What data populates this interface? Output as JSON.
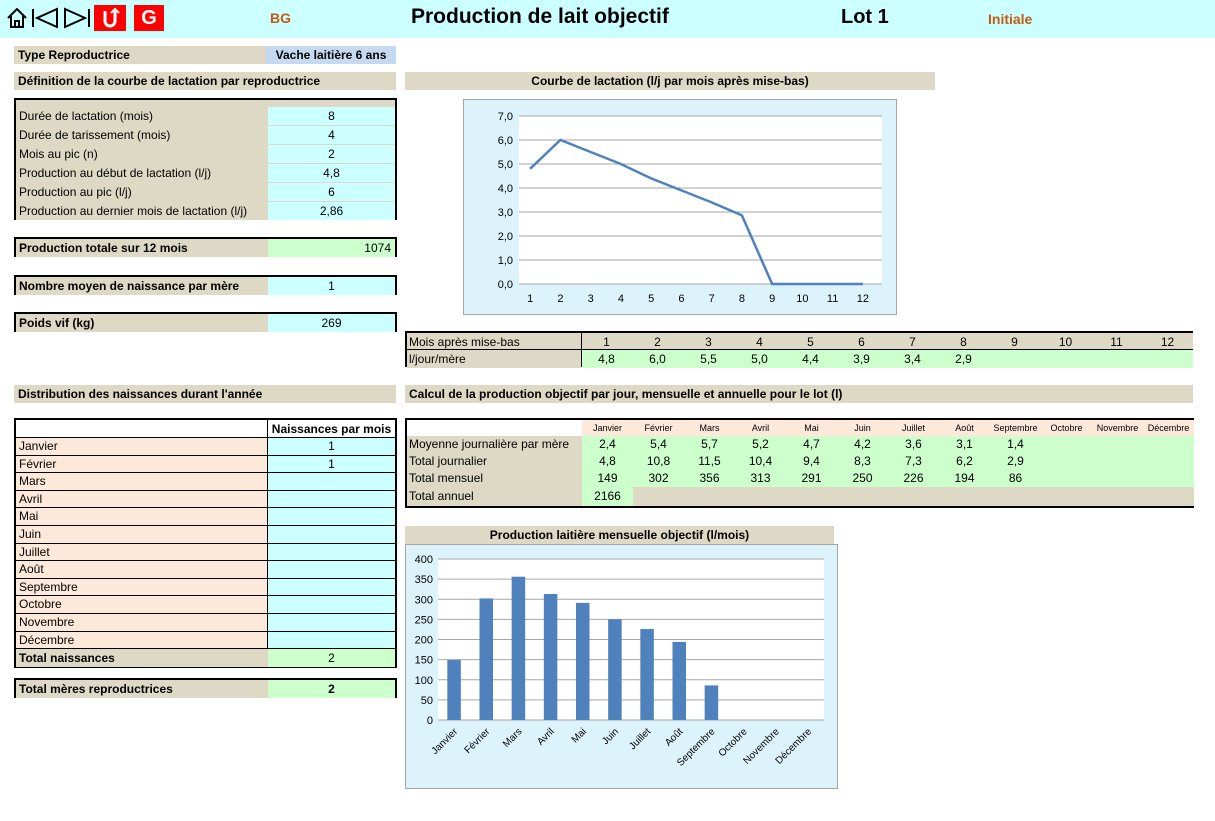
{
  "header": {
    "nav": [
      "home-icon",
      "prev-icon",
      "next-icon",
      "undo-icon",
      "refresh-icon"
    ],
    "code": "BG",
    "title": "Production de lait objectif",
    "lot": "Lot 1",
    "status": "Initiale"
  },
  "type_repro": {
    "label": "Type Reproductrice",
    "value": "Vache laitière 6 ans"
  },
  "lactation_def": {
    "title": "Définition de la courbe de lactation par reproductrice",
    "rows": [
      {
        "label": "Durée de lactation (mois)",
        "value": "8"
      },
      {
        "label": "Durée de tarissement (mois)",
        "value": "4"
      },
      {
        "label": "Mois au pic (n)",
        "value": "2"
      },
      {
        "label": "Production au début de lactation (l/j)",
        "value": "4,8"
      },
      {
        "label": "Production au pic (l/j)",
        "value": "6"
      },
      {
        "label": "Production au dernier mois de lactation (l/j)",
        "value": "2,86"
      }
    ]
  },
  "prod_totale": {
    "label": "Production totale sur 12 mois",
    "value": "1074"
  },
  "naissances_mere": {
    "label": "Nombre moyen de naissance par mère",
    "value": "1"
  },
  "poids_vif": {
    "label": "Poids vif (kg)",
    "value": "269"
  },
  "courbe_title": "Courbe de lactation (l/j par mois après mise-bas)",
  "mois_table": {
    "row1_label": "Mois après mise-bas",
    "row2_label": "l/jour/mère",
    "months": [
      "1",
      "2",
      "3",
      "4",
      "5",
      "6",
      "7",
      "8",
      "9",
      "10",
      "11",
      "12"
    ],
    "values": [
      "4,8",
      "6,0",
      "5,5",
      "5,0",
      "4,4",
      "3,9",
      "3,4",
      "2,9",
      "",
      "",
      "",
      ""
    ]
  },
  "distribution": {
    "title": "Distribution des naissances durant l'année",
    "col_header": "Naissances par mois",
    "months": [
      "Janvier",
      "Février",
      "Mars",
      "Avril",
      "Mai",
      "Juin",
      "Juillet",
      "Août",
      "Septembre",
      "Octobre",
      "Novembre",
      "Décembre"
    ],
    "values": [
      "1",
      "1",
      "",
      "",
      "",
      "",
      "",
      "",
      "",
      "",
      "",
      ""
    ],
    "total_label": "Total naissances",
    "total_value": "2"
  },
  "total_meres": {
    "label": "Total mères reproductrices",
    "value": "2"
  },
  "calcul": {
    "title": "Calcul de la production objectif par jour, mensuelle et annuelle pour le lot (l)",
    "months": [
      "Janvier",
      "Février",
      "Mars",
      "Avril",
      "Mai",
      "Juin",
      "Juillet",
      "Août",
      "Septembre",
      "Octobre",
      "Novembre",
      "Décembre"
    ],
    "rows": [
      {
        "label": "Moyenne journalière par mère",
        "values": [
          "2,4",
          "5,4",
          "5,7",
          "5,2",
          "4,7",
          "4,2",
          "3,6",
          "3,1",
          "1,4",
          "",
          "",
          ""
        ]
      },
      {
        "label": "Total journalier",
        "values": [
          "4,8",
          "10,8",
          "11,5",
          "10,4",
          "9,4",
          "8,3",
          "7,3",
          "6,2",
          "2,9",
          "",
          "",
          ""
        ]
      },
      {
        "label": "Total mensuel",
        "values": [
          "149",
          "302",
          "356",
          "313",
          "291",
          "250",
          "226",
          "194",
          "86",
          "",
          "",
          ""
        ]
      }
    ],
    "annual_label": "Total annuel",
    "annual_value": "2166"
  },
  "bar_title": "Production laitière mensuelle objectif (l/mois)",
  "chart_data": [
    {
      "type": "line",
      "title": "",
      "x": [
        1,
        2,
        3,
        4,
        5,
        6,
        7,
        8,
        9,
        10,
        11,
        12
      ],
      "series": [
        {
          "values": [
            4.8,
            6.0,
            5.5,
            5.0,
            4.4,
            3.9,
            3.4,
            2.86,
            0,
            0,
            0,
            0
          ]
        }
      ],
      "ylim": [
        0,
        7
      ],
      "yticks": [
        "0,0",
        "1,0",
        "2,0",
        "3,0",
        "4,0",
        "5,0",
        "6,0",
        "7,0"
      ],
      "color": "#4f81bd",
      "grid": true
    },
    {
      "type": "bar",
      "title": "",
      "categories": [
        "Janvier",
        "Février",
        "Mars",
        "Avril",
        "Mai",
        "Juin",
        "Juillet",
        "Août",
        "Septembre",
        "Octobre",
        "Novembre",
        "Décembre"
      ],
      "values": [
        149,
        302,
        356,
        313,
        291,
        250,
        226,
        194,
        86,
        0,
        0,
        0
      ],
      "ylim": [
        0,
        400
      ],
      "yticks": [
        "0",
        "50",
        "100",
        "150",
        "200",
        "250",
        "300",
        "350",
        "400"
      ],
      "color": "#4f81bd",
      "grid": true
    }
  ]
}
